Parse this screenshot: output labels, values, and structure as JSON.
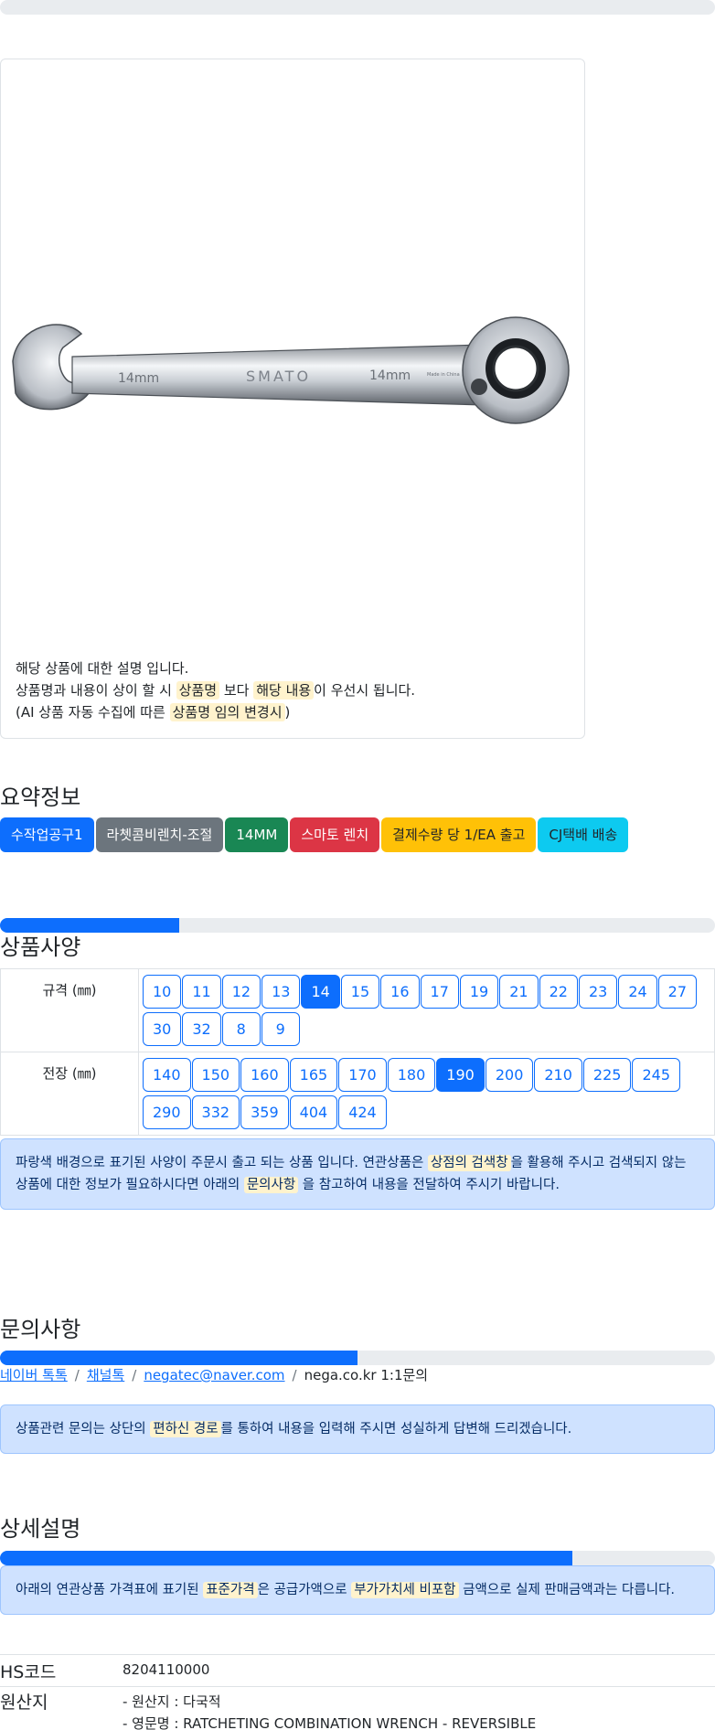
{
  "product": {
    "image_alt": "라쳇콤비렌치 SMATO 14mm",
    "image_marks": {
      "size_left": "14mm",
      "brand": "SMATO",
      "size_right": "14mm",
      "origin": "Made in China"
    },
    "desc_line1": "해당 상품에 대한 설명 입니다.",
    "desc_line2_a": "상품명과 내용이 상이 할 시 ",
    "desc_line2_hl1": "상품명",
    "desc_line2_b": " 보다 ",
    "desc_line2_hl2": "해당 내용",
    "desc_line2_c": "이 우선시 됩니다.",
    "desc_line3_a": "(AI 상품 자동 수집에 따른 ",
    "desc_line3_hl": "상품명 임의 변경시",
    "desc_line3_b": ")"
  },
  "summary": {
    "title": "요약정보",
    "badges": [
      "수작업공구1",
      "라쳇콤비렌치-조절",
      "14MM",
      "스마토 렌치",
      "결제수량 당 1/EA 출고",
      "CJ택배 배송"
    ]
  },
  "spec": {
    "title": "상품사양",
    "progress_fraction": 0.25,
    "rows": [
      {
        "label": "규격 (㎜)",
        "options": [
          "10",
          "11",
          "12",
          "13",
          "14",
          "15",
          "16",
          "17",
          "19",
          "21",
          "22",
          "23",
          "24",
          "27",
          "30",
          "32",
          "8",
          "9"
        ],
        "selected": "14"
      },
      {
        "label": "전장 (㎜)",
        "options": [
          "140",
          "150",
          "160",
          "165",
          "170",
          "180",
          "190",
          "200",
          "210",
          "225",
          "245",
          "290",
          "332",
          "359",
          "404",
          "424"
        ],
        "selected": "190"
      }
    ],
    "notice_a": "파랑색 배경으로 표기된 사양이 주문시 출고 되는 상품 입니다. 연관상품은 ",
    "notice_hl1": "상점의 검색창",
    "notice_b": "을 활용해 주시고 검색되지 않는 상품에 대한 정보가 필요하시다면 아래의 ",
    "notice_hl2": "문의사항",
    "notice_c": " 을 참고하여 내용을 전달하여 주시기 바랍니다."
  },
  "inquiry": {
    "title": "문의사항",
    "progress_fraction": 0.5,
    "links": [
      "네이버 톡톡",
      "채널톡",
      "negatec@naver.com"
    ],
    "plain": "nega.co.kr 1:1문의",
    "separator": "/",
    "notice_a": "상품관련 문의는 상단의 ",
    "notice_hl": "편하신 경로",
    "notice_b": "를 통하여 내용을 입력해 주시면 성실하게 답변해 드리겠습니다."
  },
  "detail": {
    "title": "상세설명",
    "progress_fraction": 0.8,
    "notice_a": "아래의 연관상품 가격표에 표기된 ",
    "notice_hl1": "표준가격",
    "notice_b": "은 공급가액으로 ",
    "notice_hl2": "부가가치세 비포함",
    "notice_c": " 금액으로 실제 판매금액과는 다릅니다.",
    "hs_label": "HS코드",
    "hs_value": "8204110000",
    "origin_label": "원산지",
    "origin_line1": "- 원산지 : 다국적",
    "origin_line2": "- 영문명 : RATCHETING COMBINATION WRENCH - REVERSIBLE"
  },
  "colors": {
    "primary": "#0d6efd",
    "highlight": "#fff3cd",
    "alert_bg": "#cfe2ff"
  }
}
